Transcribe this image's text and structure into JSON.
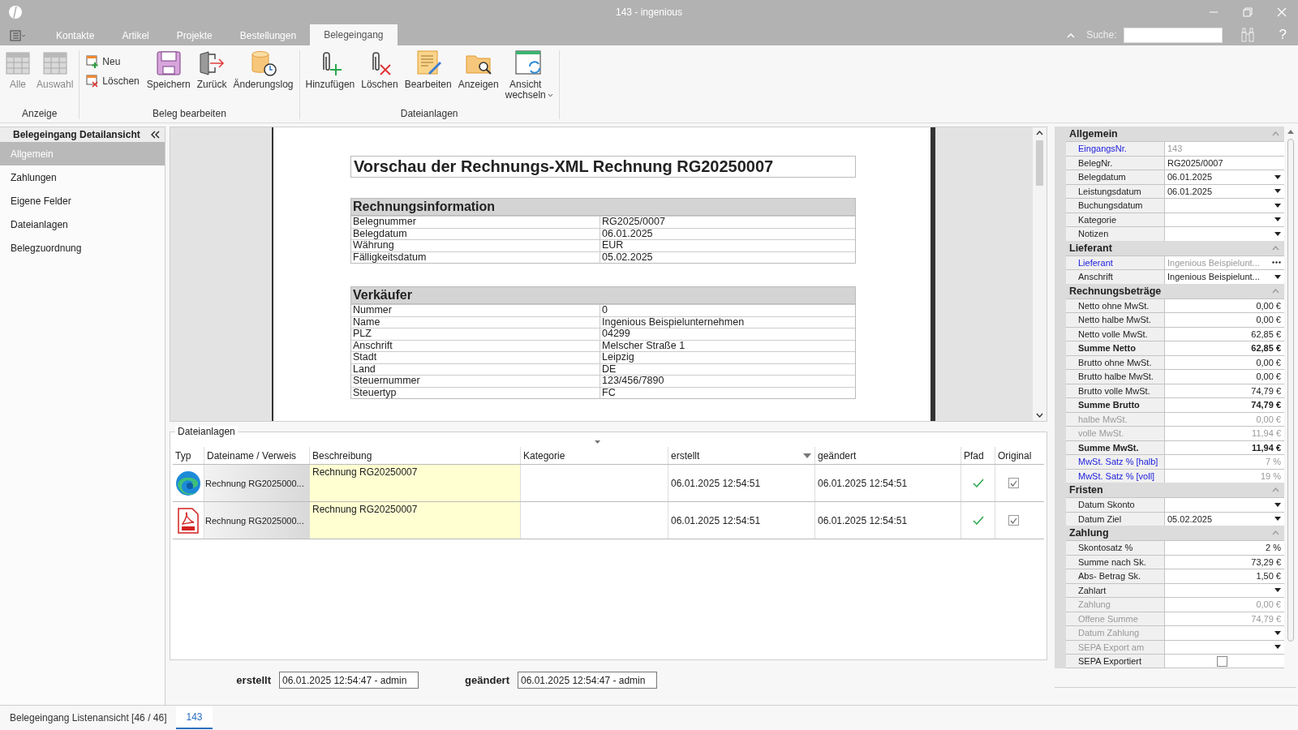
{
  "window": {
    "title": "143 - ingenious"
  },
  "menu_tabs": [
    {
      "label": "Kontakte",
      "selected": false
    },
    {
      "label": "Artikel",
      "selected": false
    },
    {
      "label": "Projekte",
      "selected": false
    },
    {
      "label": "Bestellungen",
      "selected": false
    },
    {
      "label": "Belegeingang",
      "selected": true
    }
  ],
  "search": {
    "label": "Suche:"
  },
  "help_label": "?",
  "ribbon": {
    "groups": [
      {
        "label": "Anzeige",
        "buttons": [
          {
            "label": "Alle",
            "kind": "table",
            "disabled": true
          },
          {
            "label": "Auswahl",
            "kind": "table",
            "disabled": true
          }
        ]
      },
      {
        "label": "Beleg bearbeiten",
        "buttons": [
          {
            "label": "Neu",
            "kind": "doc-new",
            "disabled": false
          },
          {
            "label": "Löschen",
            "kind": "doc-delete",
            "disabled": false
          },
          {
            "label": "Speichern",
            "kind": "save",
            "disabled": false
          },
          {
            "label": "Zurück",
            "kind": "back",
            "disabled": false
          },
          {
            "label": "Änderungslog",
            "kind": "log",
            "disabled": false
          }
        ]
      },
      {
        "label": "Dateianlagen",
        "buttons": [
          {
            "label": "Hinzufügen",
            "kind": "clip-add",
            "disabled": false
          },
          {
            "label": "Löschen",
            "kind": "clip-delete",
            "disabled": false
          },
          {
            "label": "Bearbeiten",
            "kind": "edit",
            "disabled": false
          },
          {
            "label": "Anzeigen",
            "kind": "view",
            "disabled": false
          },
          {
            "label": "Ansicht wechseln",
            "kind": "switch",
            "disabled": false,
            "dropdown": true
          }
        ]
      }
    ]
  },
  "nav": {
    "title": "Belegeingang Detailansicht",
    "items": [
      {
        "label": "Allgemein",
        "selected": true
      },
      {
        "label": "Zahlungen",
        "selected": false
      },
      {
        "label": "Eigene Felder",
        "selected": false
      },
      {
        "label": "Dateianlagen",
        "selected": false
      },
      {
        "label": "Belegzuordnung",
        "selected": false
      }
    ]
  },
  "preview": {
    "title": "Vorschau der Rechnungs-XML Rechnung RG20250007",
    "sections": [
      {
        "title": "Rechnungsinformation",
        "rows": [
          {
            "label": "Belegnummer",
            "value": "RG2025/0007"
          },
          {
            "label": "Belegdatum",
            "value": "06.01.2025"
          },
          {
            "label": "Währung",
            "value": "EUR"
          },
          {
            "label": "Fälligkeitsdatum",
            "value": "05.02.2025"
          }
        ]
      },
      {
        "title": "Verkäufer",
        "rows": [
          {
            "label": "Nummer",
            "value": "0"
          },
          {
            "label": "Name",
            "value": "Ingenious Beispielunternehmen"
          },
          {
            "label": "PLZ",
            "value": "04299"
          },
          {
            "label": "Anschrift",
            "value": "Melscher Straße 1"
          },
          {
            "label": "Stadt",
            "value": "Leipzig"
          },
          {
            "label": "Land",
            "value": "DE"
          },
          {
            "label": "Steuernummer",
            "value": "123/456/7890"
          },
          {
            "label": "Steuertyp",
            "value": "FC"
          }
        ]
      }
    ]
  },
  "attachments": {
    "title": "Dateianlagen",
    "columns": [
      {
        "label": "Typ",
        "sorted": false
      },
      {
        "label": "Dateiname / Verweis",
        "sorted": false
      },
      {
        "label": "Beschreibung",
        "sorted": false
      },
      {
        "label": "Kategorie",
        "sorted": false
      },
      {
        "label": "erstellt",
        "sorted": true
      },
      {
        "label": "geändert",
        "sorted": false
      },
      {
        "label": "Pfad",
        "sorted": false
      },
      {
        "label": "Original",
        "sorted": false
      }
    ],
    "rows": [
      {
        "kind": "browser",
        "filename": "Rechnung RG2025000...",
        "description": "Rechnung RG20250007",
        "created": "06.01.2025 12:54:51",
        "modified": "06.01.2025 12:54:51",
        "path_ok": true,
        "original": true
      },
      {
        "kind": "pdf",
        "filename": "Rechnung RG2025000...",
        "description": "Rechnung RG20250007",
        "created": "06.01.2025 12:54:51",
        "modified": "06.01.2025 12:54:51",
        "path_ok": true,
        "original": true
      }
    ]
  },
  "audit": [
    {
      "label": "erstellt",
      "value": "06.01.2025 12:54:47 - admin"
    },
    {
      "label": "geändert",
      "value": "06.01.2025 12:54:47 - admin"
    }
  ],
  "properties": {
    "sections": [
      {
        "title": "Allgemein",
        "expanded": true,
        "rows": [
          {
            "label": "EingangsNr.",
            "value": "143",
            "kind": "text",
            "bold": false,
            "link": true,
            "disabled": false
          },
          {
            "label": "BelegNr.",
            "value": "RG2025/0007",
            "kind": "text",
            "bold": false,
            "link": false,
            "disabled": false
          },
          {
            "label": "Belegdatum",
            "value": "06.01.2025",
            "kind": "dropdown",
            "bold": false,
            "link": false,
            "disabled": false
          },
          {
            "label": "Leistungsdatum",
            "value": "06.01.2025",
            "kind": "dropdown",
            "bold": false,
            "link": false,
            "disabled": false
          },
          {
            "label": "Buchungsdatum",
            "kind": "dropdown",
            "bold": false,
            "link": false,
            "disabled": false
          },
          {
            "label": "Kategorie",
            "kind": "dropdown",
            "bold": false,
            "link": false,
            "disabled": false
          },
          {
            "label": "Notizen",
            "kind": "dropdown",
            "bold": false,
            "link": false,
            "disabled": false
          }
        ]
      },
      {
        "title": "Lieferant",
        "expanded": true,
        "rows": [
          {
            "label": "Lieferant",
            "value": "Ingenious Beispielunt...",
            "kind": "lookup",
            "bold": false,
            "link": true,
            "disabled": false
          },
          {
            "label": "Anschrift",
            "value": "Ingenious Beispielunt...",
            "kind": "dropdown",
            "bold": false,
            "link": false,
            "disabled": false
          }
        ]
      },
      {
        "title": "Rechnungsbeträge",
        "expanded": true,
        "rows": [
          {
            "label": "Netto ohne MwSt.",
            "value": "0,00 €",
            "kind": "amount",
            "bold": false,
            "link": false,
            "disabled": false
          },
          {
            "label": "Netto halbe MwSt.",
            "value": "0,00 €",
            "kind": "amount",
            "bold": false,
            "link": false,
            "disabled": false
          },
          {
            "label": "Netto volle MwSt.",
            "value": "62,85 €",
            "kind": "amount",
            "bold": false,
            "link": false,
            "disabled": false
          },
          {
            "label": "Summe Netto",
            "value": "62,85 €",
            "kind": "amount",
            "bold": true,
            "link": false,
            "disabled": false
          },
          {
            "label": "Brutto ohne MwSt.",
            "value": "0,00 €",
            "kind": "amount",
            "bold": false,
            "link": false,
            "disabled": false
          },
          {
            "label": "Brutto halbe MwSt.",
            "value": "0,00 €",
            "kind": "amount",
            "bold": false,
            "link": false,
            "disabled": false
          },
          {
            "label": "Brutto volle MwSt.",
            "value": "74,79 €",
            "kind": "amount",
            "bold": false,
            "link": false,
            "disabled": false
          },
          {
            "label": "Summe Brutto",
            "value": "74,79 €",
            "kind": "amount",
            "bold": true,
            "link": false,
            "disabled": false
          },
          {
            "label": "halbe MwSt.",
            "value": "0,00 €",
            "kind": "amount",
            "bold": false,
            "link": false,
            "disabled": true
          },
          {
            "label": "volle MwSt.",
            "value": "11,94 €",
            "kind": "amount",
            "bold": false,
            "link": false,
            "disabled": true
          },
          {
            "label": "Summe MwSt.",
            "value": "11,94 €",
            "kind": "amount",
            "bold": true,
            "link": false,
            "disabled": false
          },
          {
            "label": "MwSt. Satz % [halb]",
            "value": "7 %",
            "kind": "amount",
            "bold": false,
            "link": true,
            "disabled": false
          },
          {
            "label": "MwSt. Satz % [voll]",
            "value": "19 %",
            "kind": "amount",
            "bold": false,
            "link": true,
            "disabled": false
          }
        ]
      },
      {
        "title": "Fristen",
        "expanded": true,
        "rows": [
          {
            "label": "Datum Skonto",
            "kind": "dropdown",
            "bold": false,
            "link": false,
            "disabled": false
          },
          {
            "label": "Datum Ziel",
            "value": "05.02.2025",
            "kind": "dropdown",
            "bold": false,
            "link": false,
            "disabled": false
          }
        ]
      },
      {
        "title": "Zahlung",
        "expanded": true,
        "rows": [
          {
            "label": "Skontosatz %",
            "value": "2 %",
            "kind": "amount",
            "bold": false,
            "link": false,
            "disabled": false
          },
          {
            "label": "Summe nach Sk.",
            "value": "73,29 €",
            "kind": "amount",
            "bold": false,
            "link": false,
            "disabled": false
          },
          {
            "label": "Abs- Betrag Sk.",
            "value": "1,50 €",
            "kind": "amount",
            "bold": false,
            "link": false,
            "disabled": false
          },
          {
            "label": "Zahlart",
            "kind": "dropdown",
            "bold": false,
            "link": false,
            "disabled": false
          },
          {
            "label": "Zahlung",
            "value": "0,00 €",
            "kind": "amount",
            "bold": false,
            "link": false,
            "disabled": true
          },
          {
            "label": "Offene Summe",
            "value": "74,79 €",
            "kind": "amount",
            "bold": false,
            "link": false,
            "disabled": true
          },
          {
            "label": "Datum Zahlung",
            "kind": "dropdown",
            "bold": false,
            "link": false,
            "disabled": true
          },
          {
            "label": "SEPA Export am",
            "kind": "dropdown",
            "bold": false,
            "link": false,
            "disabled": true
          },
          {
            "label": "SEPA Exportiert",
            "kind": "checkbox",
            "bold": false,
            "link": false,
            "disabled": false,
            "checked": false
          }
        ]
      }
    ]
  },
  "bottom_tabs": [
    {
      "label": "Belegeingang Listenansicht [46 / 46]",
      "selected": false
    },
    {
      "label": "143",
      "selected": true
    }
  ]
}
